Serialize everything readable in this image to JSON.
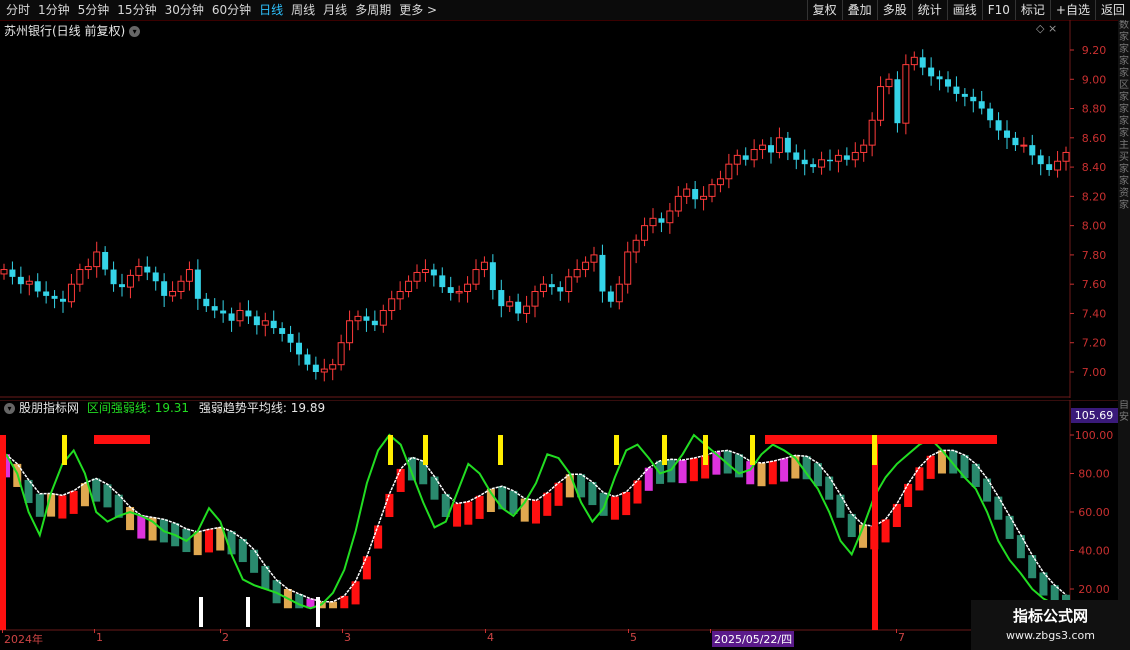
{
  "toolbar": {
    "periods": [
      "分时",
      "1分钟",
      "5分钟",
      "15分钟",
      "30分钟",
      "60分钟",
      "日线",
      "周线",
      "月线",
      "多周期",
      "更多 >"
    ],
    "active_period": "日线",
    "right_buttons": [
      "复权",
      "叠加",
      "多股",
      "统计",
      "画线",
      "F10",
      "标记",
      "+自选",
      "返回"
    ]
  },
  "main_chart": {
    "title": "苏州银行(日线 前复权)",
    "right_icons": "◇ ×",
    "y_ticks": [
      "9.20",
      "9.00",
      "8.80",
      "8.60",
      "8.40",
      "8.20",
      "8.00",
      "7.80",
      "7.60",
      "7.40",
      "7.20",
      "7.00"
    ],
    "y_values": [
      9.2,
      9.0,
      8.8,
      8.6,
      8.4,
      8.2,
      8.0,
      7.8,
      7.6,
      7.4,
      7.2,
      7.0
    ],
    "side_text": "数家家家家区家家家家主买家家资家"
  },
  "indicator": {
    "name": "股朋指标网",
    "line1_label": "区间强弱线: 19.31",
    "line2_label": "强弱趋势平均线: 19.89",
    "value_badge": "105.69",
    "y_ticks": [
      "100.00",
      "80.00",
      "60.00",
      "40.00",
      "20.00"
    ],
    "y_values": [
      100,
      80,
      60,
      40,
      20
    ],
    "side_text": "自安"
  },
  "date_axis": {
    "labels": [
      "2024年",
      "1",
      "2",
      "3",
      "4",
      "5",
      "2025/05/22/四",
      "7"
    ],
    "positions": [
      4,
      96,
      222,
      344,
      487,
      630,
      712,
      898
    ]
  },
  "watermark": {
    "line1": "指标公式网",
    "line2": "www.zbgs3.com"
  },
  "colors": {
    "up": "#ff3b3b",
    "down": "#35d4e8",
    "green_line": "#22dd22",
    "green_bar": "#2a8a6e",
    "orange_bar": "#e0a850",
    "magenta_bar": "#dd33dd",
    "red_bar": "#ff1010",
    "yellow_marker": "#ffee00",
    "white_marker": "#ffffff",
    "axis_red": "#c83030"
  },
  "chart_data": {
    "type": "candlestick",
    "price_closes": [
      7.7,
      7.65,
      7.6,
      7.62,
      7.55,
      7.52,
      7.5,
      7.48,
      7.6,
      7.7,
      7.72,
      7.82,
      7.7,
      7.6,
      7.58,
      7.66,
      7.72,
      7.68,
      7.62,
      7.52,
      7.55,
      7.62,
      7.7,
      7.5,
      7.45,
      7.42,
      7.4,
      7.35,
      7.42,
      7.38,
      7.32,
      7.35,
      7.3,
      7.26,
      7.2,
      7.12,
      7.05,
      7.0,
      7.02,
      7.05,
      7.2,
      7.35,
      7.38,
      7.35,
      7.32,
      7.42,
      7.5,
      7.55,
      7.62,
      7.68,
      7.7,
      7.66,
      7.58,
      7.54,
      7.55,
      7.6,
      7.7,
      7.75,
      7.56,
      7.45,
      7.48,
      7.4,
      7.45,
      7.55,
      7.6,
      7.58,
      7.55,
      7.65,
      7.7,
      7.75,
      7.8,
      7.55,
      7.48,
      7.6,
      7.82,
      7.9,
      8.0,
      8.05,
      8.02,
      8.1,
      8.2,
      8.25,
      8.18,
      8.2,
      8.28,
      8.32,
      8.42,
      8.48,
      8.45,
      8.52,
      8.55,
      8.5,
      8.6,
      8.5,
      8.45,
      8.42,
      8.4,
      8.45,
      8.44,
      8.48,
      8.45,
      8.5,
      8.55,
      8.72,
      8.95,
      9.0,
      8.7,
      9.1,
      9.15,
      9.08,
      9.02,
      9.0,
      8.95,
      8.9,
      8.88,
      8.85,
      8.8,
      8.72,
      8.65,
      8.6,
      8.55,
      8.55,
      8.48,
      8.42,
      8.38,
      8.44,
      8.5
    ],
    "ind_line": [
      90,
      80,
      60,
      48,
      70,
      85,
      92,
      80,
      60,
      55,
      58,
      60,
      58,
      55,
      50,
      48,
      45,
      50,
      62,
      55,
      38,
      25,
      22,
      20,
      18,
      15,
      12,
      10,
      12,
      18,
      30,
      50,
      75,
      92,
      100,
      95,
      80,
      65,
      52,
      55,
      70,
      85,
      80,
      70,
      62,
      58,
      65,
      75,
      90,
      88,
      80,
      65,
      55,
      62,
      78,
      92,
      95,
      88,
      80,
      82,
      90,
      100,
      95,
      90,
      85,
      80,
      82,
      90,
      95,
      92,
      88,
      80,
      72,
      60,
      45,
      38,
      52,
      68,
      78,
      85,
      90,
      95,
      98,
      92,
      85,
      78,
      72,
      60,
      45,
      35,
      28,
      20,
      15,
      12,
      10
    ]
  }
}
